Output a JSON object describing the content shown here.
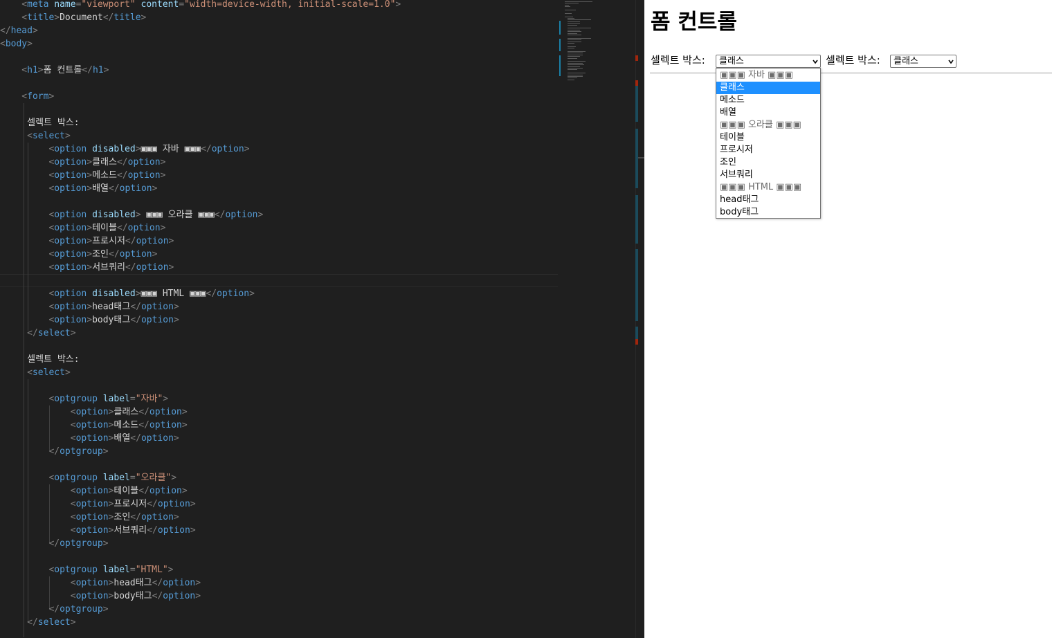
{
  "editor": {
    "code_lines": [
      [
        [
          "punct",
          "    <"
        ],
        [
          "tag",
          "meta"
        ],
        [
          "text",
          " "
        ],
        [
          "attr",
          "name"
        ],
        [
          "punct",
          "="
        ],
        [
          "str",
          "\"viewport\""
        ],
        [
          "text",
          " "
        ],
        [
          "attr",
          "content"
        ],
        [
          "punct",
          "="
        ],
        [
          "str",
          "\"width=device-width, initial-scale=1.0\""
        ],
        [
          "punct",
          ">"
        ]
      ],
      [
        [
          "punct",
          "    <"
        ],
        [
          "tag",
          "title"
        ],
        [
          "punct",
          ">"
        ],
        [
          "text",
          "Document"
        ],
        [
          "punct",
          "</"
        ],
        [
          "tag",
          "title"
        ],
        [
          "punct",
          ">"
        ]
      ],
      [
        [
          "punct",
          "</"
        ],
        [
          "tag",
          "head"
        ],
        [
          "punct",
          ">"
        ]
      ],
      [
        [
          "punct",
          "<"
        ],
        [
          "tag",
          "body"
        ],
        [
          "punct",
          ">"
        ]
      ],
      [],
      [
        [
          "punct",
          "    <"
        ],
        [
          "tag",
          "h1"
        ],
        [
          "punct",
          ">"
        ],
        [
          "text",
          "폼 컨트롤"
        ],
        [
          "punct",
          "</"
        ],
        [
          "tag",
          "h1"
        ],
        [
          "punct",
          ">"
        ]
      ],
      [],
      [
        [
          "punct",
          "    <"
        ],
        [
          "tag",
          "form"
        ],
        [
          "punct",
          ">"
        ]
      ],
      [],
      [
        [
          "text",
          "     셀렉트 박스:"
        ]
      ],
      [
        [
          "punct",
          "     <"
        ],
        [
          "tag",
          "select"
        ],
        [
          "punct",
          ">"
        ]
      ],
      [
        [
          "punct",
          "         <"
        ],
        [
          "tag",
          "option"
        ],
        [
          "text",
          " "
        ],
        [
          "attr",
          "disabled"
        ],
        [
          "punct",
          ">"
        ],
        [
          "text",
          "▣▣▣ 자바 ▣▣▣"
        ],
        [
          "punct",
          "</"
        ],
        [
          "tag",
          "option"
        ],
        [
          "punct",
          ">"
        ]
      ],
      [
        [
          "punct",
          "         <"
        ],
        [
          "tag",
          "option"
        ],
        [
          "punct",
          ">"
        ],
        [
          "text",
          "클래스"
        ],
        [
          "punct",
          "</"
        ],
        [
          "tag",
          "option"
        ],
        [
          "punct",
          ">"
        ]
      ],
      [
        [
          "punct",
          "         <"
        ],
        [
          "tag",
          "option"
        ],
        [
          "punct",
          ">"
        ],
        [
          "text",
          "메소드"
        ],
        [
          "punct",
          "</"
        ],
        [
          "tag",
          "option"
        ],
        [
          "punct",
          ">"
        ]
      ],
      [
        [
          "punct",
          "         <"
        ],
        [
          "tag",
          "option"
        ],
        [
          "punct",
          ">"
        ],
        [
          "text",
          "배열"
        ],
        [
          "punct",
          "</"
        ],
        [
          "tag",
          "option"
        ],
        [
          "punct",
          ">"
        ]
      ],
      [],
      [
        [
          "punct",
          "         <"
        ],
        [
          "tag",
          "option"
        ],
        [
          "text",
          " "
        ],
        [
          "attr",
          "disabled"
        ],
        [
          "punct",
          ">"
        ],
        [
          "text",
          " ▣▣▣ 오라클 ▣▣▣"
        ],
        [
          "punct",
          "</"
        ],
        [
          "tag",
          "option"
        ],
        [
          "punct",
          ">"
        ]
      ],
      [
        [
          "punct",
          "         <"
        ],
        [
          "tag",
          "option"
        ],
        [
          "punct",
          ">"
        ],
        [
          "text",
          "테이블"
        ],
        [
          "punct",
          "</"
        ],
        [
          "tag",
          "option"
        ],
        [
          "punct",
          ">"
        ]
      ],
      [
        [
          "punct",
          "         <"
        ],
        [
          "tag",
          "option"
        ],
        [
          "punct",
          ">"
        ],
        [
          "text",
          "프로시저"
        ],
        [
          "punct",
          "</"
        ],
        [
          "tag",
          "option"
        ],
        [
          "punct",
          ">"
        ]
      ],
      [
        [
          "punct",
          "         <"
        ],
        [
          "tag",
          "option"
        ],
        [
          "punct",
          ">"
        ],
        [
          "text",
          "조인"
        ],
        [
          "punct",
          "</"
        ],
        [
          "tag",
          "option"
        ],
        [
          "punct",
          ">"
        ]
      ],
      [
        [
          "punct",
          "         <"
        ],
        [
          "tag",
          "option"
        ],
        [
          "punct",
          ">"
        ],
        [
          "text",
          "서브쿼리"
        ],
        [
          "punct",
          "</"
        ],
        [
          "tag",
          "option"
        ],
        [
          "punct",
          ">"
        ]
      ],
      [],
      [
        [
          "punct",
          "         <"
        ],
        [
          "tag",
          "option"
        ],
        [
          "text",
          " "
        ],
        [
          "attr",
          "disabled"
        ],
        [
          "punct",
          ">"
        ],
        [
          "text",
          "▣▣▣ HTML ▣▣▣"
        ],
        [
          "punct",
          "</"
        ],
        [
          "tag",
          "option"
        ],
        [
          "punct",
          ">"
        ]
      ],
      [
        [
          "punct",
          "         <"
        ],
        [
          "tag",
          "option"
        ],
        [
          "punct",
          ">"
        ],
        [
          "text",
          "head태그"
        ],
        [
          "punct",
          "</"
        ],
        [
          "tag",
          "option"
        ],
        [
          "punct",
          ">"
        ]
      ],
      [
        [
          "punct",
          "         <"
        ],
        [
          "tag",
          "option"
        ],
        [
          "punct",
          ">"
        ],
        [
          "text",
          "body태그"
        ],
        [
          "punct",
          "</"
        ],
        [
          "tag",
          "option"
        ],
        [
          "punct",
          ">"
        ]
      ],
      [
        [
          "punct",
          "     </"
        ],
        [
          "tag",
          "select"
        ],
        [
          "punct",
          ">"
        ]
      ],
      [],
      [
        [
          "text",
          "     셀렉트 박스:"
        ]
      ],
      [
        [
          "punct",
          "     <"
        ],
        [
          "tag",
          "select"
        ],
        [
          "punct",
          ">"
        ]
      ],
      [],
      [
        [
          "punct",
          "         <"
        ],
        [
          "tag",
          "optgroup"
        ],
        [
          "text",
          " "
        ],
        [
          "attr",
          "label"
        ],
        [
          "punct",
          "="
        ],
        [
          "str",
          "\"자바\""
        ],
        [
          "punct",
          ">"
        ]
      ],
      [
        [
          "punct",
          "             <"
        ],
        [
          "tag",
          "option"
        ],
        [
          "punct",
          ">"
        ],
        [
          "text",
          "클래스"
        ],
        [
          "punct",
          "</"
        ],
        [
          "tag",
          "option"
        ],
        [
          "punct",
          ">"
        ]
      ],
      [
        [
          "punct",
          "             <"
        ],
        [
          "tag",
          "option"
        ],
        [
          "punct",
          ">"
        ],
        [
          "text",
          "메소드"
        ],
        [
          "punct",
          "</"
        ],
        [
          "tag",
          "option"
        ],
        [
          "punct",
          ">"
        ]
      ],
      [
        [
          "punct",
          "             <"
        ],
        [
          "tag",
          "option"
        ],
        [
          "punct",
          ">"
        ],
        [
          "text",
          "배열"
        ],
        [
          "punct",
          "</"
        ],
        [
          "tag",
          "option"
        ],
        [
          "punct",
          ">"
        ]
      ],
      [
        [
          "punct",
          "         </"
        ],
        [
          "tag",
          "optgroup"
        ],
        [
          "punct",
          ">"
        ]
      ],
      [],
      [
        [
          "punct",
          "         <"
        ],
        [
          "tag",
          "optgroup"
        ],
        [
          "text",
          " "
        ],
        [
          "attr",
          "label"
        ],
        [
          "punct",
          "="
        ],
        [
          "str",
          "\"오라클\""
        ],
        [
          "punct",
          ">"
        ]
      ],
      [
        [
          "punct",
          "             <"
        ],
        [
          "tag",
          "option"
        ],
        [
          "punct",
          ">"
        ],
        [
          "text",
          "테이블"
        ],
        [
          "punct",
          "</"
        ],
        [
          "tag",
          "option"
        ],
        [
          "punct",
          ">"
        ]
      ],
      [
        [
          "punct",
          "             <"
        ],
        [
          "tag",
          "option"
        ],
        [
          "punct",
          ">"
        ],
        [
          "text",
          "프로시저"
        ],
        [
          "punct",
          "</"
        ],
        [
          "tag",
          "option"
        ],
        [
          "punct",
          ">"
        ]
      ],
      [
        [
          "punct",
          "             <"
        ],
        [
          "tag",
          "option"
        ],
        [
          "punct",
          ">"
        ],
        [
          "text",
          "조인"
        ],
        [
          "punct",
          "</"
        ],
        [
          "tag",
          "option"
        ],
        [
          "punct",
          ">"
        ]
      ],
      [
        [
          "punct",
          "             <"
        ],
        [
          "tag",
          "option"
        ],
        [
          "punct",
          ">"
        ],
        [
          "text",
          "서브쿼리"
        ],
        [
          "punct",
          "</"
        ],
        [
          "tag",
          "option"
        ],
        [
          "punct",
          ">"
        ]
      ],
      [
        [
          "punct",
          "         </"
        ],
        [
          "tag",
          "optgroup"
        ],
        [
          "punct",
          ">"
        ]
      ],
      [],
      [
        [
          "punct",
          "         <"
        ],
        [
          "tag",
          "optgroup"
        ],
        [
          "text",
          " "
        ],
        [
          "attr",
          "label"
        ],
        [
          "punct",
          "="
        ],
        [
          "str",
          "\"HTML\""
        ],
        [
          "punct",
          ">"
        ]
      ],
      [
        [
          "punct",
          "             <"
        ],
        [
          "tag",
          "option"
        ],
        [
          "punct",
          ">"
        ],
        [
          "text",
          "head태그"
        ],
        [
          "punct",
          "</"
        ],
        [
          "tag",
          "option"
        ],
        [
          "punct",
          ">"
        ]
      ],
      [
        [
          "punct",
          "             <"
        ],
        [
          "tag",
          "option"
        ],
        [
          "punct",
          ">"
        ],
        [
          "text",
          "body태그"
        ],
        [
          "punct",
          "</"
        ],
        [
          "tag",
          "option"
        ],
        [
          "punct",
          ">"
        ]
      ],
      [
        [
          "punct",
          "         </"
        ],
        [
          "tag",
          "optgroup"
        ],
        [
          "punct",
          ">"
        ]
      ],
      [
        [
          "punct",
          "     </"
        ],
        [
          "tag",
          "select"
        ],
        [
          "punct",
          ">"
        ]
      ]
    ],
    "colors": {
      "background": "#1f1f1f",
      "punct": "#808080",
      "tag": "#569cd6",
      "attr": "#9cdcfe",
      "string": "#ce9178",
      "text": "#d4d4d4"
    }
  },
  "preview": {
    "title": "폼 컨트롤",
    "select1": {
      "label": "셀렉트 박스:",
      "selected": "클래스",
      "open": true,
      "options": [
        {
          "text": "▣▣▣ 자바 ▣▣▣",
          "disabled": true
        },
        {
          "text": "클래스",
          "selected": true
        },
        {
          "text": "메소드"
        },
        {
          "text": "배열"
        },
        {
          "text": "▣▣▣ 오라클 ▣▣▣",
          "disabled": true
        },
        {
          "text": "테이블"
        },
        {
          "text": "프로시저"
        },
        {
          "text": "조인"
        },
        {
          "text": "서브쿼리"
        },
        {
          "text": "▣▣▣ HTML ▣▣▣",
          "disabled": true
        },
        {
          "text": "head태그"
        },
        {
          "text": "body태그"
        }
      ]
    },
    "select2": {
      "label": "셀렉트 박스:",
      "selected": "클래스"
    },
    "colors": {
      "highlight": "#1e90ff",
      "disabled_text": "#6d6d6d"
    },
    "icons": {
      "select_arrow": "chevron-down-icon"
    }
  }
}
